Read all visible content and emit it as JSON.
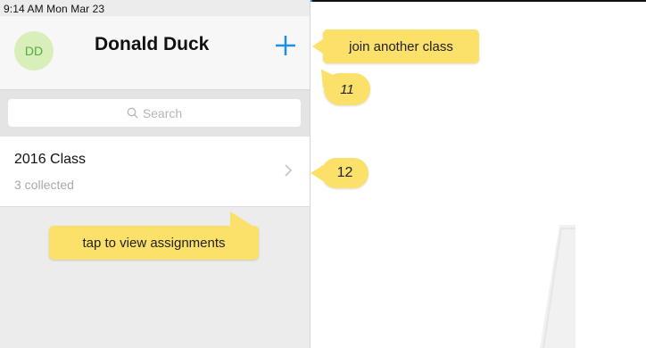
{
  "status_bar": {
    "time_date": "9:14 AM   Mon Mar 23"
  },
  "header": {
    "avatar_initials": "DD",
    "user_name": "Donald Duck",
    "add_icon": "plus-icon",
    "accent_color": "#1e8fe8"
  },
  "search": {
    "placeholder": "Search",
    "icon": "search-icon"
  },
  "classes": [
    {
      "name": "2016 Class",
      "subtitle": "3 collected"
    }
  ],
  "callouts": {
    "join": "join another class",
    "step_11": "11",
    "step_12": "12",
    "tap": "tap to view assignments",
    "color": "#fbe06a"
  }
}
